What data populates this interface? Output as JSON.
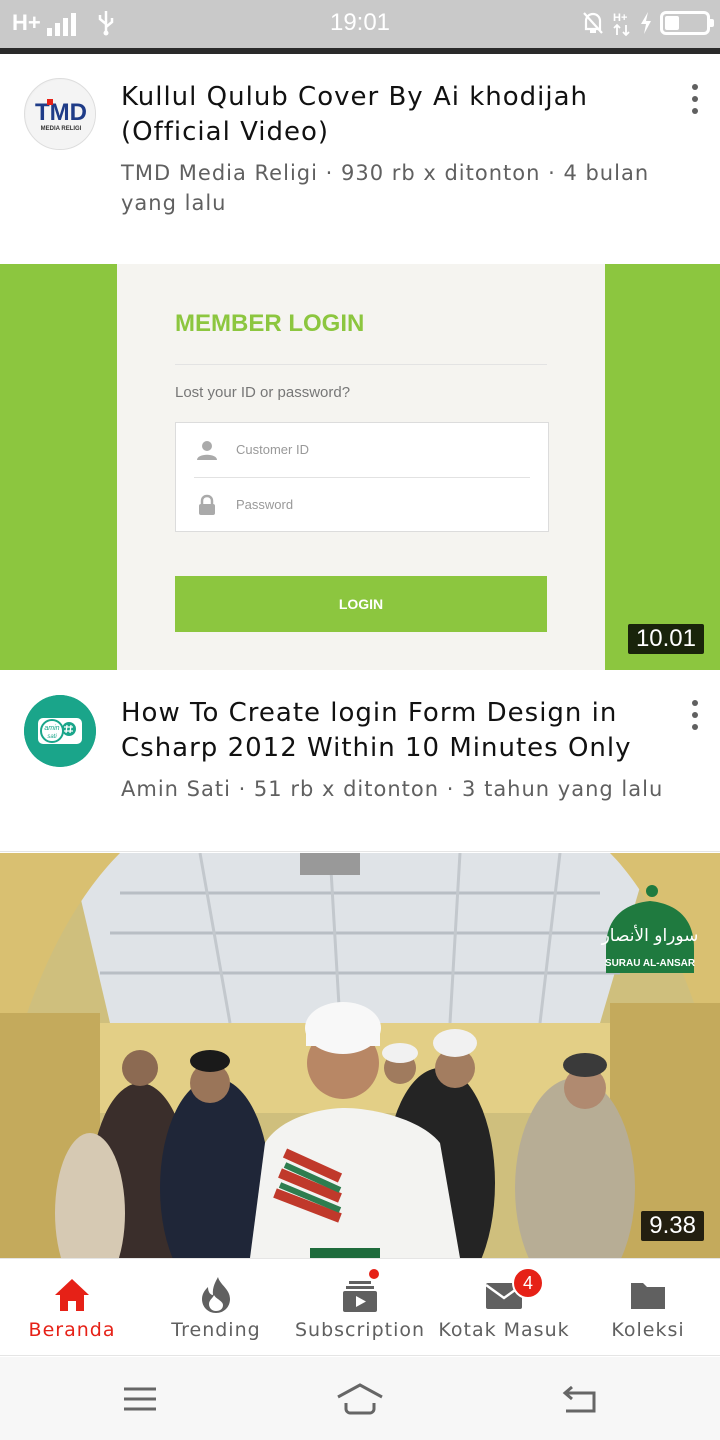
{
  "status_bar": {
    "network": "H+",
    "time": "19:01",
    "data_indicator": "H+"
  },
  "feed": [
    {
      "title": "Kullul Qulub Cover By Ai khodijah (Official Video)",
      "meta": "TMD Media Religi · 930 rb x ditonton · 4 bulan yang lalu",
      "channel_logo": {
        "main": "TMD",
        "sub": "MEDIA RELIGI"
      }
    },
    {
      "thumbnail": {
        "heading": "MEMBER LOGIN",
        "lost_text": "Lost your ID or password?",
        "customer_id_placeholder": "Customer ID",
        "password_placeholder": "Password",
        "button": "LOGIN"
      },
      "duration": "10.01",
      "title": "How To Create login Form Design in Csharp 2012 Within 10 Minutes Only",
      "meta": "Amin Sati · 51 rb x ditonton · 3 tahun yang lalu",
      "channel_logo": {
        "main": "amin",
        "sub": "sati"
      }
    },
    {
      "thumbnail": {
        "logo_arabic": "سوراو الأنصار",
        "logo_latin": "SURAU AL-ANSAR"
      },
      "duration": "9.38"
    }
  ],
  "bottom_nav": {
    "items": [
      {
        "label": "Beranda",
        "icon": "home-icon",
        "active": true
      },
      {
        "label": "Trending",
        "icon": "flame-icon"
      },
      {
        "label": "Subscription",
        "icon": "subscriptions-icon"
      },
      {
        "label": "Kotak Masuk",
        "icon": "inbox-icon",
        "badge": "4"
      },
      {
        "label": "Koleksi",
        "icon": "folder-icon"
      }
    ]
  },
  "colors": {
    "accent": "#e62117",
    "thumbnail_green": "#8cc63f",
    "text_secondary": "#606060"
  }
}
